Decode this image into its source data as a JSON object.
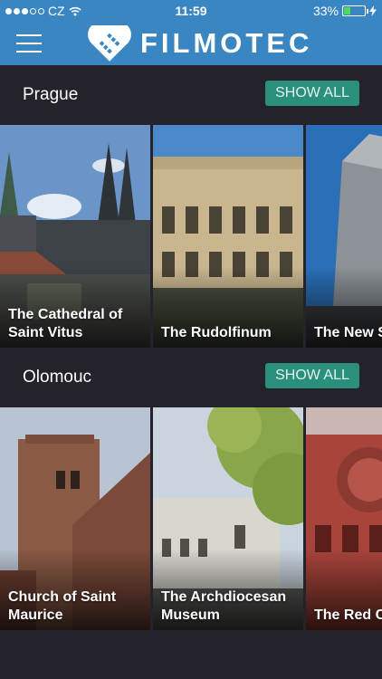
{
  "status": {
    "carrier": "CZ",
    "time": "11:59",
    "battery": "33%",
    "battery_level": 0.33
  },
  "header": {
    "brand": "FILMOTEC"
  },
  "sections": [
    {
      "title": "Prague",
      "show_all_label": "SHOW ALL",
      "cards": [
        {
          "label": "The Cathedral of\nSaint Vitus"
        },
        {
          "label": "The Rudolfinum"
        },
        {
          "label": "The New S"
        }
      ]
    },
    {
      "title": "Olomouc",
      "show_all_label": "SHOW ALL",
      "cards": [
        {
          "label": "Church of Saint\nMaurice"
        },
        {
          "label": "The Archdiocesan\nMuseum"
        },
        {
          "label": "The Red C"
        }
      ]
    }
  ]
}
